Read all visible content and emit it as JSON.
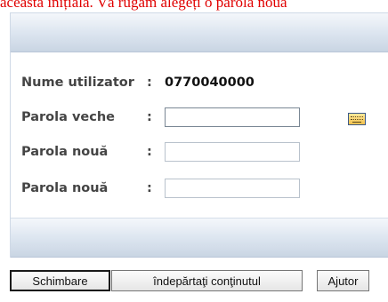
{
  "notice": "această inițială. Vă rugăm alegeți o parolă nouă",
  "form": {
    "username_label": "Nume utilizator",
    "username_colon": ":",
    "username_value": "0770040000",
    "old_password_label": "Parola veche",
    "old_password_colon": ":",
    "old_password_value": "",
    "new_password_label": "Parola nouă",
    "new_password_colon": ":",
    "new_password_value": "",
    "confirm_password_label": "Parola nouă",
    "confirm_password_colon": ":",
    "confirm_password_value": ""
  },
  "icons": {
    "virtual_keyboard": "keyboard-icon"
  },
  "buttons": {
    "change": "Schimbare",
    "clear": "îndepărtaţi conţinutul",
    "help": "Ajutor"
  },
  "colors": {
    "notice": "#e00000",
    "bar": "#d4dee9"
  }
}
